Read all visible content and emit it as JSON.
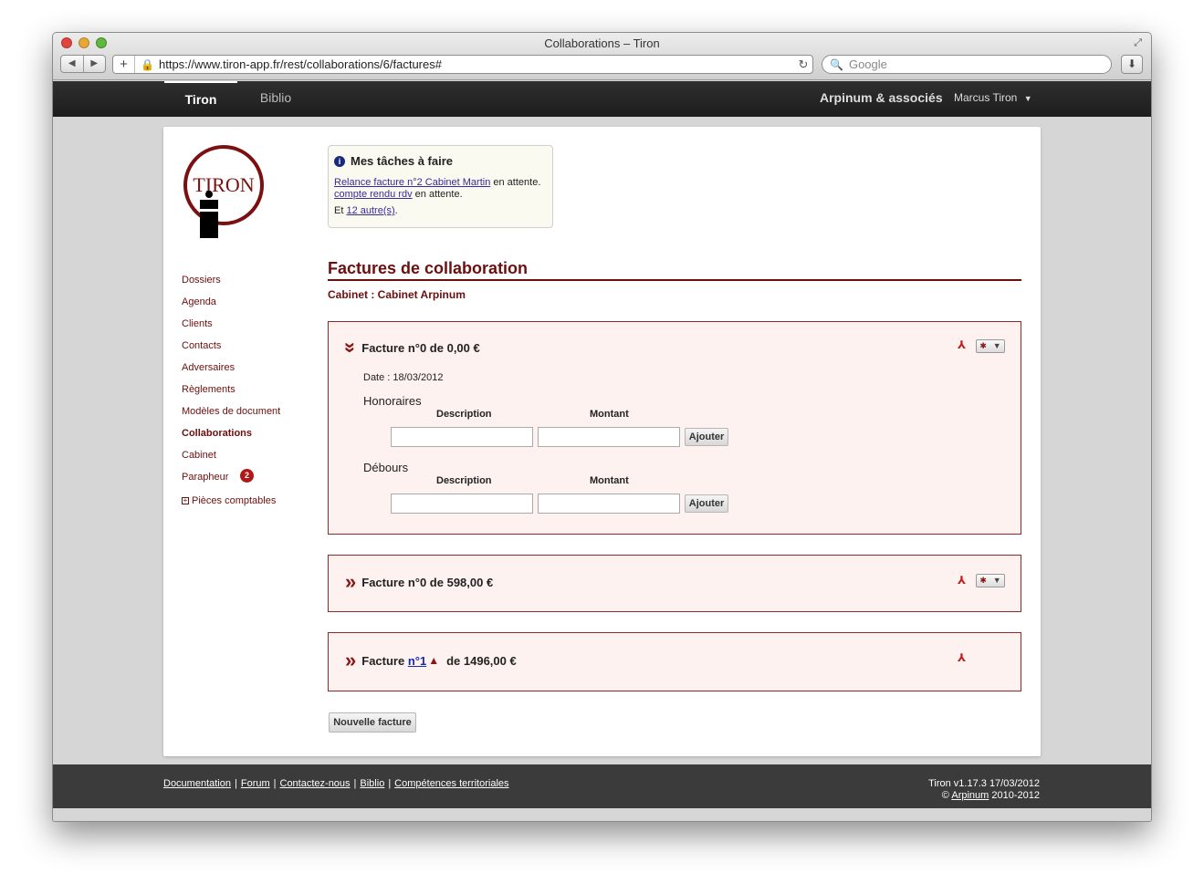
{
  "window": {
    "title": "Collaborations – Tiron"
  },
  "browser": {
    "url": "https://www.tiron-app.fr/rest/collaborations/6/factures#",
    "search_placeholder": "Google"
  },
  "appnav": {
    "tabs": [
      {
        "label": "Tiron"
      },
      {
        "label": "Biblio"
      }
    ],
    "firm": "Arpinum & associés",
    "user": "Marcus Tiron"
  },
  "logo": {
    "text": "TIRON"
  },
  "sidebar": {
    "items": [
      {
        "label": "Dossiers"
      },
      {
        "label": "Agenda"
      },
      {
        "label": "Clients"
      },
      {
        "label": "Contacts"
      },
      {
        "label": "Adversaires"
      },
      {
        "label": "Règlements"
      },
      {
        "label": "Modèles de document"
      },
      {
        "label": "Collaborations"
      },
      {
        "label": "Cabinet"
      },
      {
        "label": "Parapheur",
        "badge": "2"
      },
      {
        "label": "Pièces comptables"
      }
    ]
  },
  "tasks": {
    "title": "Mes tâches à faire",
    "line1_link": "Relance facture n°2 Cabinet Martin",
    "line1_suffix": " en attente.",
    "line2_link": "compte rendu rdv",
    "line2_suffix": " en attente.",
    "line3_prefix": "Et ",
    "line3_link": "12 autre(s)",
    "line3_suffix": "."
  },
  "page": {
    "title": "Factures de collaboration",
    "cabinet": "Cabinet : Cabinet Arpinum"
  },
  "invoices": [
    {
      "title": "Facture n°0 de 0,00 €",
      "date": "Date : 18/03/2012",
      "honoraires": "Honoraires",
      "debours": "Débours",
      "col_description": "Description",
      "col_montant": "Montant",
      "add_label": "Ajouter"
    },
    {
      "title": "Facture n°0 de 598,00 €"
    },
    {
      "prefix": "Facture ",
      "link": "n°1",
      "suffix": "de 1496,00 €"
    }
  ],
  "new_invoice_label": "Nouvelle facture",
  "footer": {
    "links": [
      {
        "label": "Documentation"
      },
      {
        "label": "Forum"
      },
      {
        "label": "Contactez-nous"
      },
      {
        "label": "Biblio"
      },
      {
        "label": "Compétences territoriales"
      }
    ],
    "version": "Tiron v1.17.3 17/03/2012",
    "copy_prefix": "© ",
    "copy_link": "Arpinum",
    "copy_suffix": " 2010-2012"
  },
  "colors": {
    "brand": "#6b0f0f",
    "panel_bg": "#fdf2ef",
    "tasks_bg": "#fbfaf0"
  }
}
